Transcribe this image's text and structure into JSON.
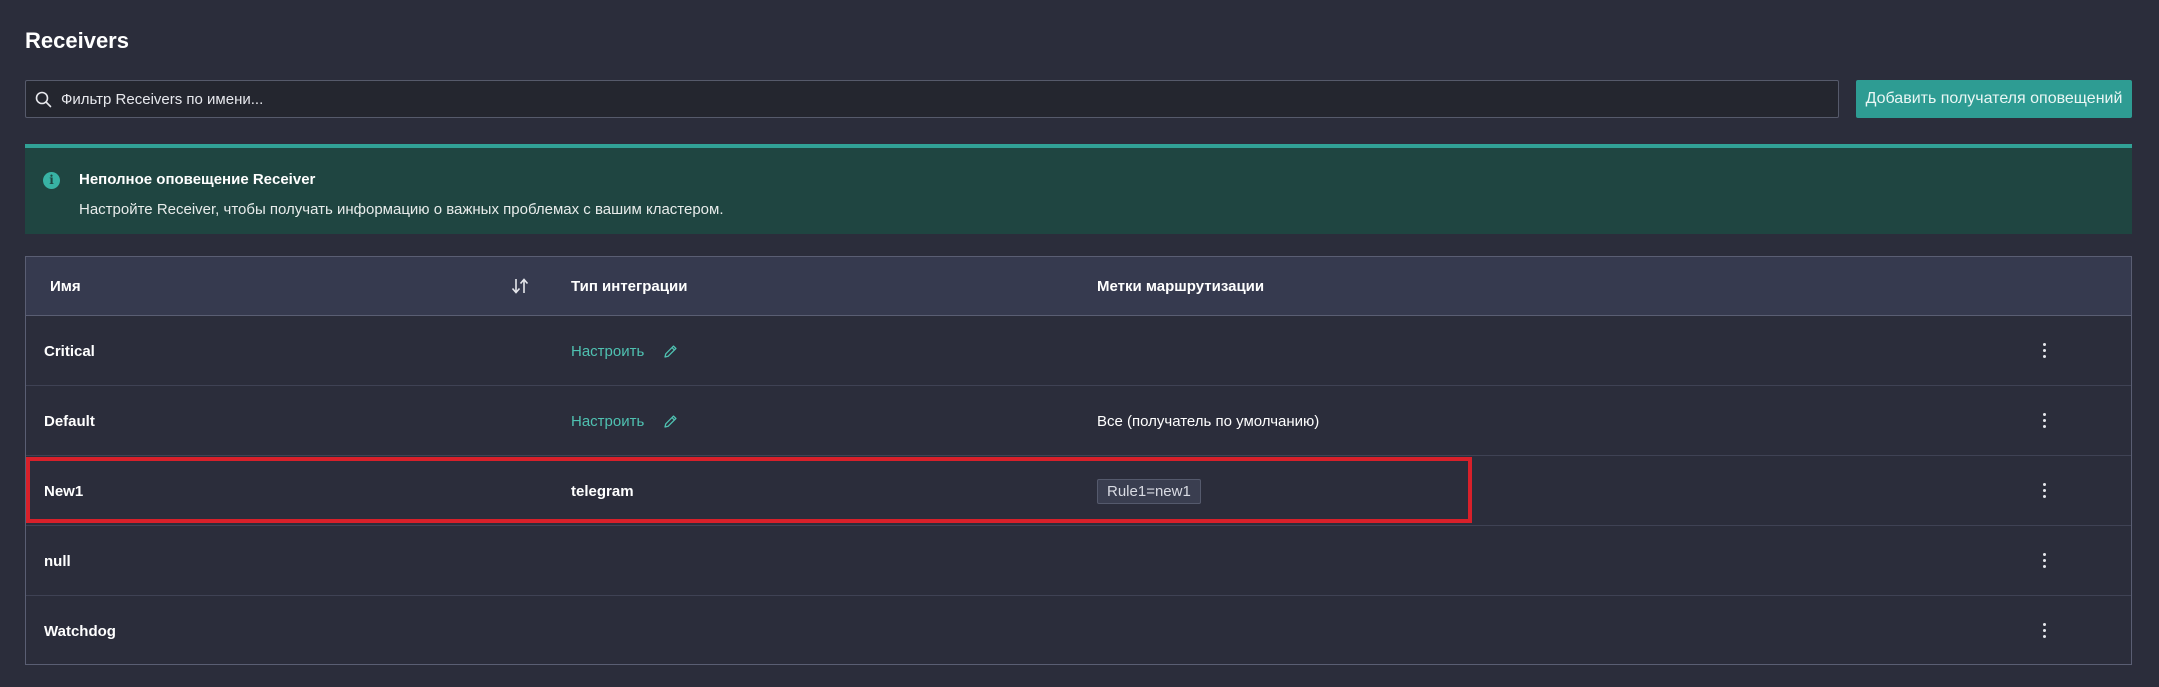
{
  "page": {
    "title": "Receivers"
  },
  "toolbar": {
    "search_placeholder": "Фильтр Receivers по имени...",
    "add_button_label": "Добавить получателя оповещений"
  },
  "alert": {
    "title": "Неполное оповещение Receiver",
    "text": "Настройте Receiver, чтобы получать информацию о важных проблемах с вашим кластером."
  },
  "table": {
    "headers": {
      "name": "Имя",
      "integration": "Тип интеграции",
      "labels": "Метки маршрутизации"
    },
    "rows": [
      {
        "name": "Critical",
        "integration_link": "Настроить",
        "labels": ""
      },
      {
        "name": "Default",
        "integration_link": "Настроить",
        "labels": "Все (получатель по умолчанию)"
      },
      {
        "name": "New1",
        "integration": "telegram",
        "label_chip": "Rule1=new1"
      },
      {
        "name": "null"
      },
      {
        "name": "Watchdog"
      }
    ]
  },
  "colors": {
    "accent": "#2e9c93",
    "link": "#4fc1b1",
    "highlight": "#d8202a",
    "alert_bg": "#1f4541"
  }
}
